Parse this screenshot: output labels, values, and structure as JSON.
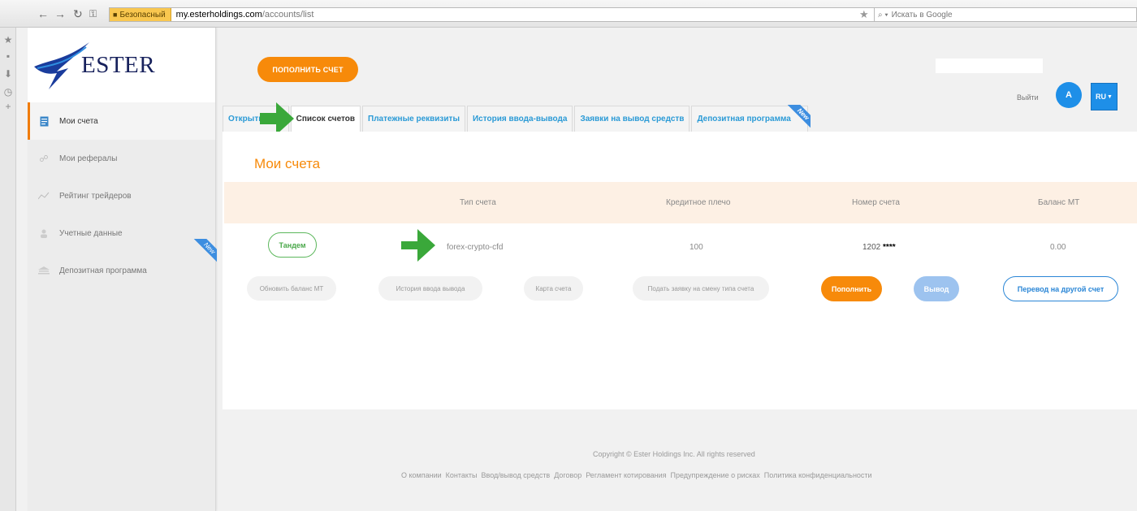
{
  "browser": {
    "secure_label": "Безопасный",
    "url_domain": "my.esterholdings.com",
    "url_path": "/accounts/list",
    "search_placeholder": "Искать в Google"
  },
  "sidebar": {
    "logo_text": "ESTER",
    "items": [
      {
        "label": "Мои счета",
        "icon": "document-icon",
        "active": true
      },
      {
        "label": "Мои рефералы",
        "icon": "users-icon"
      },
      {
        "label": "Рейтинг трейдеров",
        "icon": "chart-line-icon"
      },
      {
        "label": "Учетные данные",
        "icon": "user-icon"
      },
      {
        "label": "Депозитная программа",
        "icon": "deposit-icon",
        "badge": "New"
      }
    ]
  },
  "header": {
    "topup_label": "ПОПОЛНИТЬ СЧЕТ",
    "logout_label": "Выйти",
    "avatar_initial": "A",
    "language": "RU"
  },
  "tabs": [
    {
      "label": "Открыть счет"
    },
    {
      "label": "Список счетов",
      "active": true
    },
    {
      "label": "Платежные реквизиты"
    },
    {
      "label": "История ввода-вывода"
    },
    {
      "label": "Заявки на вывод средств"
    },
    {
      "label": "Депозитная программа",
      "badge": "New"
    }
  ],
  "main": {
    "title": "Мои счета",
    "table": {
      "columns": [
        "Тип счета",
        "Кредитное плечо",
        "Номер счета",
        "Баланс МТ"
      ],
      "row": {
        "tag": "Тандем",
        "type": "forex-crypto-cfd",
        "leverage": "100",
        "account_prefix": "1202",
        "account_mask": "****",
        "balance": "0.00"
      }
    },
    "actions": {
      "refresh_balance": "Обновить баланс МТ",
      "history": "История ввода вывода",
      "account_card": "Карта счета",
      "change_type": "Подать заявку на смену типа счета",
      "deposit": "Пополнить",
      "withdraw": "Вывод",
      "transfer": "Перевод на другой счет"
    }
  },
  "footer": {
    "copyright": "Copyright © Ester Holdings Inc. All rights reserved",
    "links": [
      "О компании",
      "Контакты",
      "Ввод/вывод средств",
      "Договор",
      "Регламент котирования",
      "Предупреждение о рисках",
      "Политика конфиденциальности"
    ]
  },
  "colors": {
    "accent_orange": "#f78a0a",
    "accent_blue": "#1e8fe8",
    "arrow_green": "#3aa83a"
  }
}
